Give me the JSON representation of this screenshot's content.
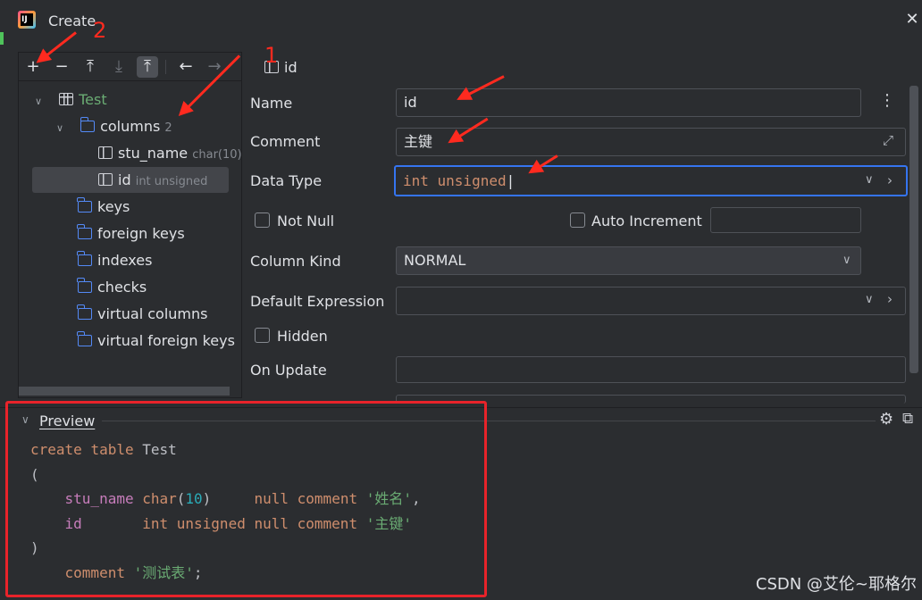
{
  "window": {
    "title": "Create",
    "logo_text": "IJ"
  },
  "tree": {
    "toolbar": [
      "add",
      "remove",
      "move-up",
      "move-down",
      "move-top",
      "back",
      "forward"
    ],
    "table": {
      "label": "Test"
    },
    "columns": {
      "label": "columns",
      "count": "2"
    },
    "col1": {
      "name": "stu_name",
      "type": "char(10)"
    },
    "col2": {
      "name": "id",
      "type": "int unsigned"
    },
    "folders": [
      "keys",
      "foreign keys",
      "indexes",
      "checks",
      "virtual columns",
      "virtual foreign keys"
    ]
  },
  "form": {
    "header": "id",
    "name_label": "Name",
    "name_value": "id",
    "comment_label": "Comment",
    "comment_value": "主键",
    "datatype_label": "Data Type",
    "datatype_value": "int unsigned",
    "notnull_label": "Not Null",
    "autoinc_label": "Auto Increment",
    "kind_label": "Column Kind",
    "kind_value": "NORMAL",
    "default_label": "Default Expression",
    "hidden_label": "Hidden",
    "onupdate_label": "On Update"
  },
  "preview": {
    "title": "Preview",
    "code": {
      "l1a": "create",
      "l1b": "table",
      "l1c": "Test",
      "l2": "(",
      "r1": {
        "name": "stu_name",
        "type": "char",
        "num": "10",
        "nul": "null",
        "cm": "comment",
        "str": "'姓名'"
      },
      "r2": {
        "name": "id",
        "type": "int unsigned",
        "nul": "null",
        "cm": "comment",
        "str": "'主键'"
      },
      "l5": ")",
      "l6a": "comment",
      "l6b": "'测试表'",
      "l6c": ";"
    }
  },
  "annotations": {
    "one": "1",
    "two": "2"
  },
  "watermark": "CSDN @艾伦~耶格尔",
  "colors": {
    "accent": "#3574f0",
    "folder": "#548af7",
    "annotation": "#ff2a1f"
  }
}
